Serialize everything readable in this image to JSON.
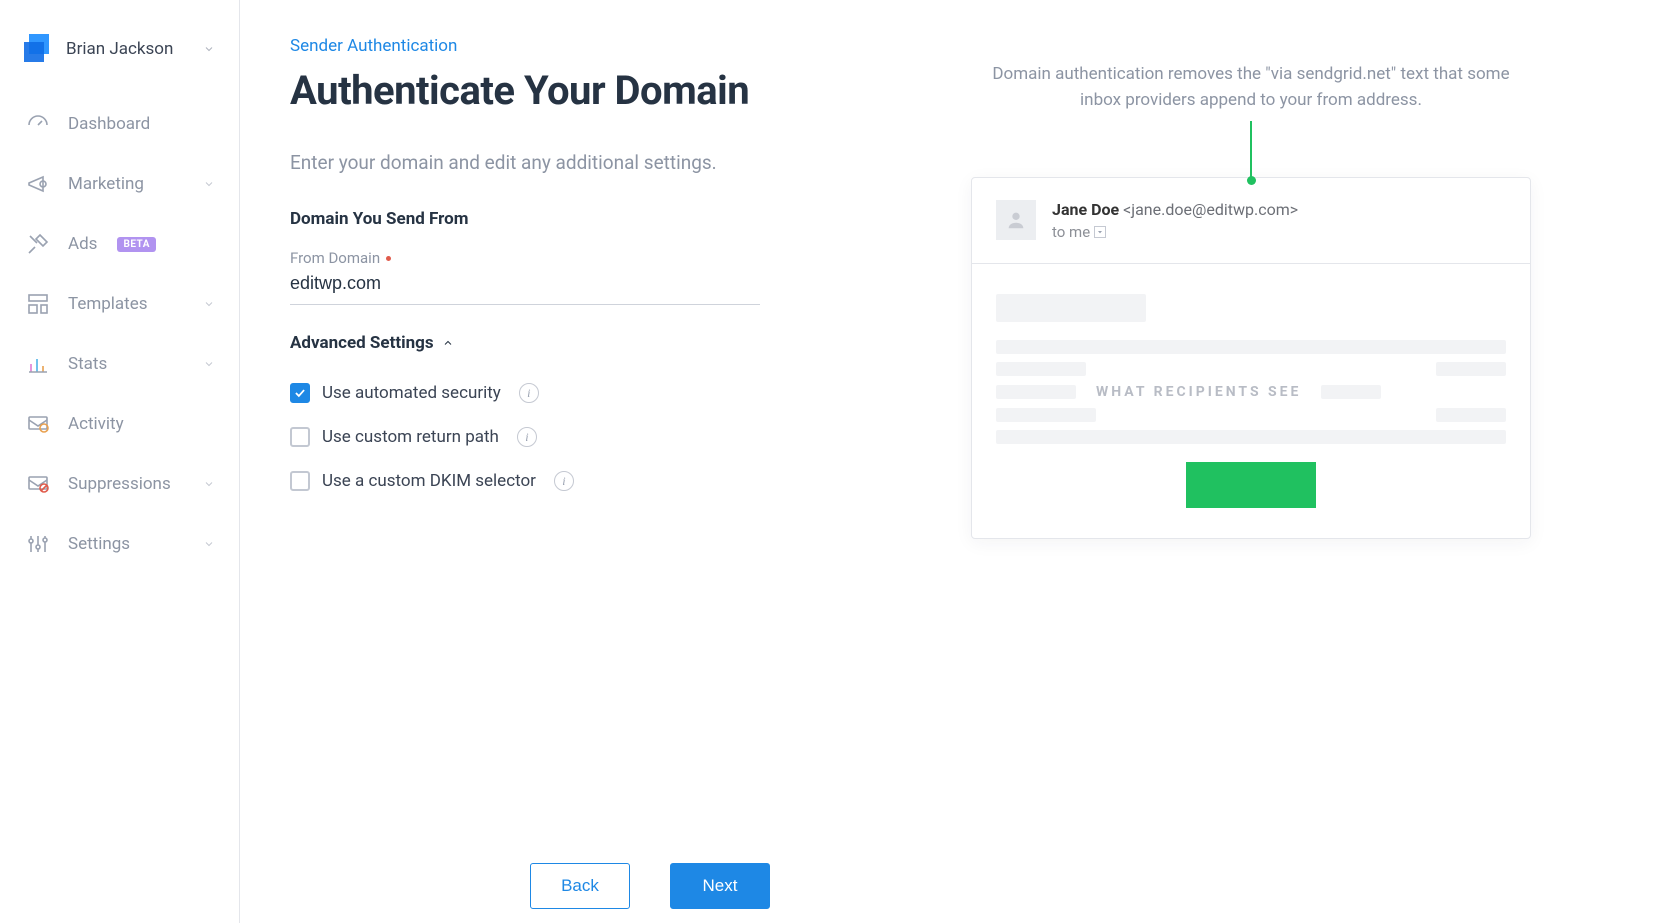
{
  "user": {
    "name": "Brian Jackson"
  },
  "sidebar": {
    "items": [
      {
        "label": "Dashboard",
        "icon": "dashboard",
        "expandable": false
      },
      {
        "label": "Marketing",
        "icon": "marketing",
        "expandable": true
      },
      {
        "label": "Ads",
        "icon": "ads",
        "badge": "BETA",
        "expandable": false
      },
      {
        "label": "Templates",
        "icon": "templates",
        "expandable": true
      },
      {
        "label": "Stats",
        "icon": "stats",
        "expandable": true
      },
      {
        "label": "Activity",
        "icon": "activity",
        "expandable": false
      },
      {
        "label": "Suppressions",
        "icon": "suppressions",
        "expandable": true
      },
      {
        "label": "Settings",
        "icon": "settings",
        "expandable": true
      }
    ]
  },
  "page": {
    "eyebrow": "Sender Authentication",
    "title": "Authenticate Your Domain",
    "intro": "Enter your domain and edit any additional settings.",
    "section1_title": "Domain You Send From",
    "from_domain_label": "From Domain",
    "from_domain_value": "editwp.com",
    "advanced_title": "Advanced Settings",
    "options": [
      {
        "label": "Use automated security",
        "checked": true
      },
      {
        "label": "Use custom return path",
        "checked": false
      },
      {
        "label": "Use a custom DKIM selector",
        "checked": false
      }
    ],
    "help_text": "Domain authentication removes the \"via sendgrid.net\" text that some inbox providers append to your from address.",
    "back_label": "Back",
    "next_label": "Next"
  },
  "preview": {
    "sender_name": "Jane Doe",
    "sender_email": "<jane.doe@editwp.com>",
    "recipient_line": "to me",
    "watermark": "WHAT RECIPIENTS SEE"
  }
}
